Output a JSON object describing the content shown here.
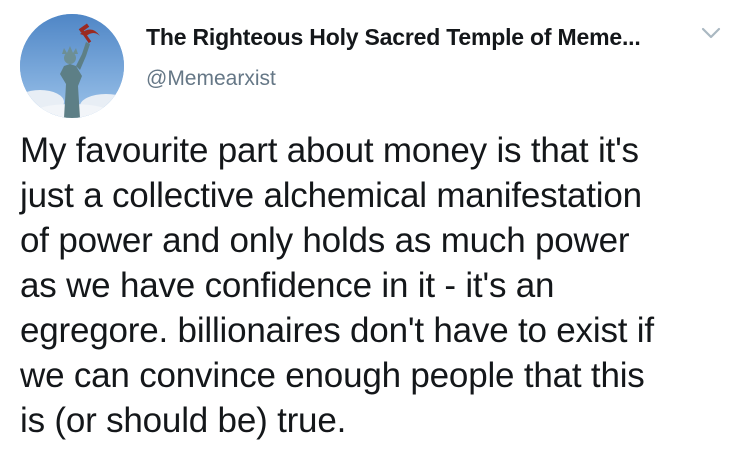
{
  "author": {
    "display_name": "The Righteous Holy Sacred Temple of Meme...",
    "handle": "@Memearxist",
    "avatar_icon": "statue-of-liberty-hammer-sickle-avatar"
  },
  "menu": {
    "icon": "chevron-down-icon"
  },
  "tweet": {
    "text": "My favourite part about money is that it's\njust a collective alchemical manifestation\nof power and only holds as much power\nas we have confidence in it - it's an\negregore. billionaires don't have to exist if\nwe can convince enough people that this\nis (or should be) true."
  },
  "colors": {
    "text": "#14171a",
    "secondary_text": "#657786",
    "avatar_sky": "#6f9fd2"
  }
}
